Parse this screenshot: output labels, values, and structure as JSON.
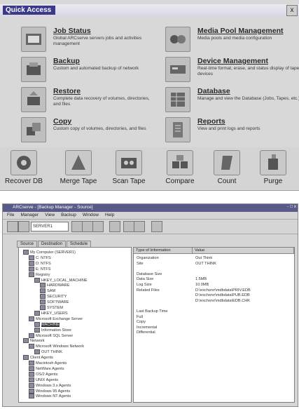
{
  "quick_access": {
    "title": "Quick Access",
    "close": "x",
    "items": [
      {
        "name": "Job Status",
        "desc": "Global ARCserve servers jobs and activities management",
        "icon": "job-status-icon"
      },
      {
        "name": "Media Pool Management",
        "desc": "Media pools and media configuration",
        "icon": "media-pool-icon"
      },
      {
        "name": "Backup",
        "desc": "Custom and automated backup of network",
        "icon": "backup-icon"
      },
      {
        "name": "Device Management",
        "desc": "Real-time format, erase, and status display of tape devices",
        "icon": "device-icon"
      },
      {
        "name": "Restore",
        "desc": "Complete data recovery of volumes, directories, and files",
        "icon": "restore-icon"
      },
      {
        "name": "Database",
        "desc": "Manage and view the Database (Jobs, Tapes, etc.)",
        "icon": "database-icon"
      },
      {
        "name": "Copy",
        "desc": "Custom copy of volumes, directories, and files",
        "icon": "copy-icon"
      },
      {
        "name": "Reports",
        "desc": "View and print logs and reports",
        "icon": "reports-icon"
      }
    ],
    "bottom": [
      {
        "label": "Recover DB",
        "icon": "recover-db-icon"
      },
      {
        "label": "Merge Tape",
        "icon": "merge-tape-icon"
      },
      {
        "label": "Scan Tape",
        "icon": "scan-tape-icon"
      },
      {
        "label": "Compare",
        "icon": "compare-icon"
      },
      {
        "label": "Count",
        "icon": "count-icon"
      },
      {
        "label": "Purge",
        "icon": "purge-icon"
      }
    ]
  },
  "manager": {
    "title": "ARCserve - [Backup Manager - Source]",
    "window_controls": "-  □  x",
    "menu": [
      "File",
      "Manager",
      "View",
      "Backup",
      "Window",
      "Help"
    ],
    "server_field": "SERVER1",
    "tabs": [
      "Source",
      "Destination",
      "Schedule"
    ],
    "tree": [
      {
        "text": "My Computer (SERVER1)",
        "level": 0
      },
      {
        "text": "C: NTFS",
        "level": 1
      },
      {
        "text": "D: NTFS",
        "level": 1
      },
      {
        "text": "E: NTFS",
        "level": 1
      },
      {
        "text": "Registry",
        "level": 1
      },
      {
        "text": "HKEY_LOCAL_MACHINE",
        "level": 2
      },
      {
        "text": "HARDWARE",
        "level": 3
      },
      {
        "text": "SAM",
        "level": 3
      },
      {
        "text": "SECURITY",
        "level": 3
      },
      {
        "text": "SOFTWARE",
        "level": 3
      },
      {
        "text": "SYSTEM",
        "level": 3
      },
      {
        "text": "HKEY_USERS",
        "level": 2
      },
      {
        "text": "Microsoft Exchange Server",
        "level": 1
      },
      {
        "text": "MACHINE",
        "level": 2,
        "selected": true
      },
      {
        "text": "Information Store",
        "level": 2
      },
      {
        "text": "Microsoft SQL Server",
        "level": 1
      },
      {
        "text": "Network",
        "level": 0
      },
      {
        "text": "Microsoft Windows Network",
        "level": 1
      },
      {
        "text": "OUT THINK",
        "level": 2
      },
      {
        "text": "Client Agents",
        "level": 0
      },
      {
        "text": "Macintosh Agents",
        "level": 1
      },
      {
        "text": "NetWare Agents",
        "level": 1
      },
      {
        "text": "OS/2 Agents",
        "level": 1
      },
      {
        "text": "UNIX Agents",
        "level": 1
      },
      {
        "text": "Windows 3.x Agents",
        "level": 1
      },
      {
        "text": "Windows 95 Agents",
        "level": 1
      },
      {
        "text": "Windows NT Agents",
        "level": 1
      }
    ],
    "right_headers": [
      "Type of Information",
      "Value"
    ],
    "rows": [
      {
        "k": "Organization",
        "v": "Out Think"
      },
      {
        "k": "Site",
        "v": "OUT THINK"
      },
      {
        "k": "",
        "v": ""
      },
      {
        "k": "Database Size",
        "v": ""
      },
      {
        "k": "Data Size",
        "v": "1.5MB"
      },
      {
        "k": "Log Size",
        "v": "10.0MB"
      },
      {
        "k": "Related Files",
        "v": "D:\\exchsrvr\\mdbdata\\PRIV.EDB"
      },
      {
        "k": "",
        "v": "D:\\exchsrvr\\mdbdata\\PUB.EDB"
      },
      {
        "k": "",
        "v": "D:\\exchsrvr\\mdbdata\\EDB.CHK"
      },
      {
        "k": "",
        "v": ""
      },
      {
        "k": "Last Backup Time",
        "v": ""
      },
      {
        "k": "Full",
        "v": ""
      },
      {
        "k": "Copy",
        "v": ""
      },
      {
        "k": "Incremental",
        "v": ""
      },
      {
        "k": "Differential",
        "v": ""
      }
    ]
  }
}
